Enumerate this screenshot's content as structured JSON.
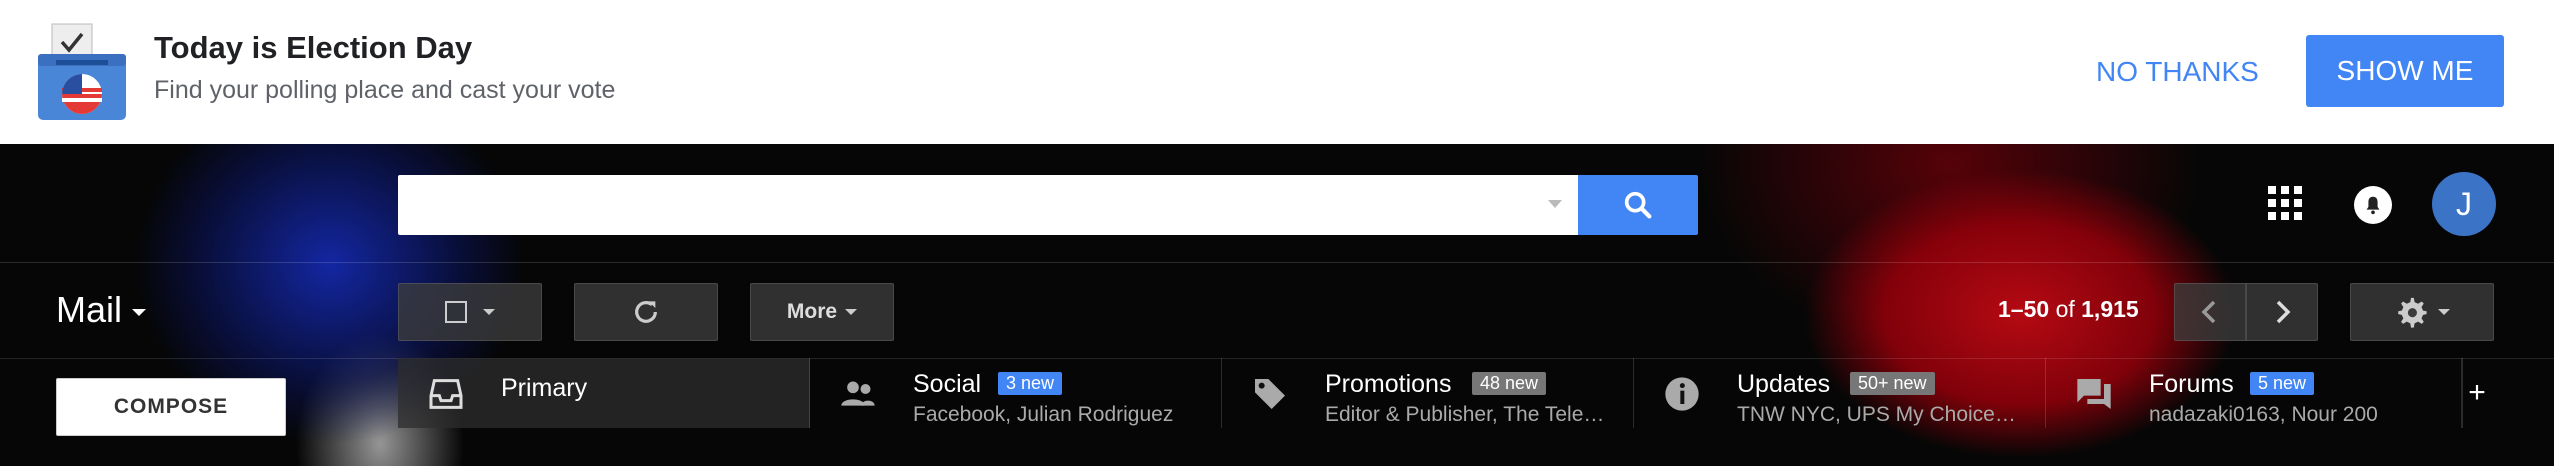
{
  "banner": {
    "title": "Today is Election Day",
    "subtitle": "Find your polling place and cast your vote",
    "no_thanks_label": "NO THANKS",
    "show_me_label": "SHOW ME",
    "icon": "ballot-box-icon"
  },
  "header": {
    "search": {
      "value": "",
      "placeholder": ""
    },
    "avatar_initial": "J",
    "icons": [
      "search-icon",
      "apps-grid-icon",
      "notifications-bell-icon"
    ]
  },
  "toolbar": {
    "app_label": "Mail",
    "more_label": "More",
    "pager": {
      "range": "1–50",
      "of_label": "of",
      "total": "1,915"
    }
  },
  "sidebar": {
    "compose_label": "COMPOSE"
  },
  "tabs": [
    {
      "label": "Primary",
      "badge": "",
      "sub": "",
      "icon": "inbox-icon"
    },
    {
      "label": "Social",
      "badge": "3 new",
      "badge_color": "#4285f4",
      "sub": "Facebook, Julian Rodriguez",
      "icon": "people-icon"
    },
    {
      "label": "Promotions",
      "badge": "48 new",
      "badge_color": "#777777",
      "sub": "Editor & Publisher, The Tele…",
      "icon": "tag-icon"
    },
    {
      "label": "Updates",
      "badge": "50+ new",
      "badge_color": "#777777",
      "sub": "TNW NYC, UPS My Choice…",
      "icon": "info-icon"
    },
    {
      "label": "Forums",
      "badge": "5 new",
      "badge_color": "#4285f4",
      "sub": "nadazaki0163, Nour 200",
      "icon": "forum-icon"
    }
  ],
  "colors": {
    "accent": "#4285f4",
    "avatar": "#3b74c7"
  }
}
